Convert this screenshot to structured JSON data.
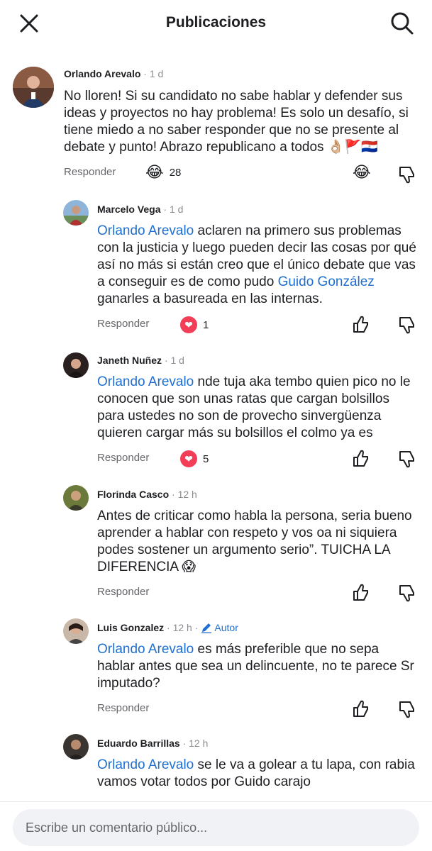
{
  "header": {
    "title": "Publicaciones"
  },
  "labels": {
    "reply": "Responder"
  },
  "comments": [
    {
      "author": "Orlando Arevalo",
      "time": "· 1 d",
      "text": "No lloren! Si su candidato no sabe hablar y defender sus ideas y proyectos no hay problema! Es solo un desafío, si tiene miedo a no saber responder que no se presente al debate y punto! Abrazo republicano a todos 👌🏼🚩🇵🇾",
      "reaction_icon": "😂",
      "reaction_count": "28"
    },
    {
      "author": "Marcelo Vega",
      "time": "· 1 d",
      "mention": "Orlando Arevalo",
      "text_a": " aclaren na primero sus problemas con la justicia y luego pueden decir las cosas por qué así no más si están creo que el único debate que vas a conseguir es de como pudo ",
      "mention2": "Guido González",
      "text_b": " ganarles a basureada en las internas.",
      "reaction_icon": "❤",
      "reaction_count": "1"
    },
    {
      "author": "Janeth Nuñez",
      "time": "· 1 d",
      "mention": "Orlando Arevalo",
      "text": " nde tuja aka tembo quien pico no le conocen que son unas ratas que cargan bolsillos para ustedes no son de provecho sinvergüenza quieren cargar más su bolsillos el colmo ya es",
      "reaction_icon": "❤",
      "reaction_count": "5"
    },
    {
      "author": "Florinda Casco",
      "time": "· 12 h",
      "text": "Antes de criticar como habla la persona, seria bueno aprender a hablar con respeto y vos oa ni siquiera podes sostener un argumento serio”. TUICHA LA DIFERENCIA 😱"
    },
    {
      "author": "Luis Gonzalez",
      "time": "· 12 h ·",
      "badge": "Autor",
      "mention": "Orlando Arevalo",
      "text": " es más preferible que no sepa hablar antes que sea un delincuente, no te parece Sr imputado?"
    },
    {
      "author": "Eduardo Barrillas",
      "time": "· 12 h",
      "mention": "Orlando Arevalo",
      "text": " se le va a golear a tu lapa, con rabia vamos votar todos por Guido carajo"
    }
  ],
  "composer": {
    "placeholder": "Escribe un comentario público..."
  }
}
